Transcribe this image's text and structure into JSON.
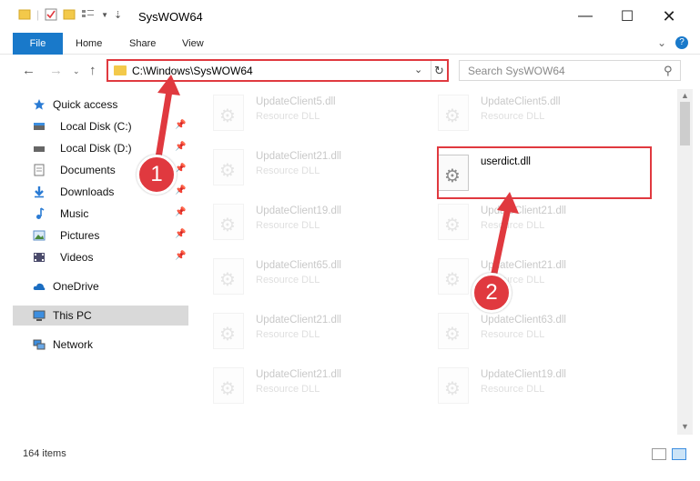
{
  "window": {
    "title": "SysWOW64",
    "minimize": "—",
    "maximize": "☐",
    "close": "✕"
  },
  "ribbon": {
    "tabs": [
      "File",
      "Home",
      "Share",
      "View"
    ],
    "expand_icon": "chevron-down-icon",
    "help_icon": "help-icon"
  },
  "address": {
    "path": "C:\\Windows\\SysWOW64",
    "search_placeholder": "Search SysWOW64"
  },
  "nav_pane": {
    "items": [
      {
        "label": "Quick access",
        "icon": "star-icon",
        "pinned": false
      },
      {
        "label": "Local Disk (C:)",
        "icon": "drive-icon",
        "pinned": true
      },
      {
        "label": "Local Disk (D:)",
        "icon": "drive-icon",
        "pinned": true
      },
      {
        "label": "Documents",
        "icon": "documents-icon",
        "pinned": true
      },
      {
        "label": "Downloads",
        "icon": "download-icon",
        "pinned": true
      },
      {
        "label": "Music",
        "icon": "music-icon",
        "pinned": true
      },
      {
        "label": "Pictures",
        "icon": "pictures-icon",
        "pinned": true
      },
      {
        "label": "Videos",
        "icon": "videos-icon",
        "pinned": true
      },
      {
        "label": "OneDrive",
        "icon": "cloud-icon",
        "pinned": false
      },
      {
        "label": "This PC",
        "icon": "computer-icon",
        "pinned": false,
        "selected": true
      },
      {
        "label": "Network",
        "icon": "network-icon",
        "pinned": false
      }
    ]
  },
  "files": {
    "left_column": [
      {
        "name": "UpdateClient5.dll",
        "type": "Resource DLL"
      },
      {
        "name": "UpdateClient21.dll",
        "type": "Resource DLL"
      },
      {
        "name": "UpdateClient19.dll",
        "type": "Resource DLL"
      },
      {
        "name": "UpdateClient65.dll",
        "type": "Resource DLL"
      },
      {
        "name": "UpdateClient21.dll",
        "type": "Resource DLL"
      },
      {
        "name": "UpdateClient21.dll",
        "type": "Resource DLL"
      }
    ],
    "right_column": [
      {
        "name": "UpdateClient5.dll",
        "type": "Resource DLL"
      },
      {
        "name": "userdict.dll",
        "type": "",
        "highlighted": true
      },
      {
        "name": "UpdateClient21.dll",
        "type": "Resource DLL"
      },
      {
        "name": "UpdateClient21.dll",
        "type": "Resource DLL"
      },
      {
        "name": "UpdateClient63.dll",
        "type": "Resource DLL"
      },
      {
        "name": "UpdateClient19.dll",
        "type": "Resource DLL"
      }
    ]
  },
  "status": {
    "item_count": "164 items"
  },
  "callouts": [
    {
      "number": "1"
    },
    {
      "number": "2"
    }
  ],
  "colors": {
    "accent": "#1979ca",
    "highlight_red": "#e0393f",
    "selected_bg": "#d9d9d9"
  }
}
